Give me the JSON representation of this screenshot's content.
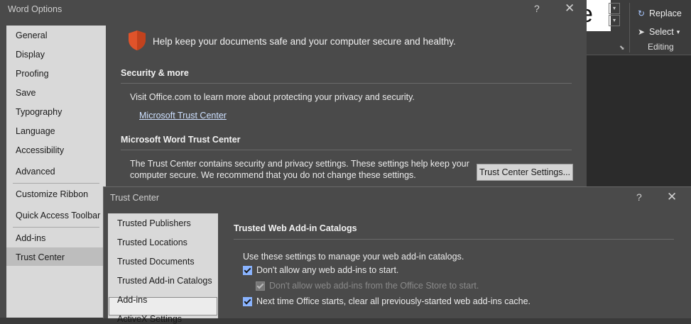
{
  "ribbon": {
    "font_preview": "e",
    "replace_label": "Replace",
    "select_label": "Select",
    "group_label": "Editing"
  },
  "word_options": {
    "title": "Word Options",
    "help": "?",
    "close": "✕",
    "nav": [
      "General",
      "Display",
      "Proofing",
      "Save",
      "Typography",
      "Language",
      "Accessibility",
      "Advanced",
      "Customize Ribbon",
      "Quick Access Toolbar",
      "Add-ins",
      "Trust Center"
    ],
    "selected_nav": "Trust Center",
    "headline": "Help keep your documents safe and your computer secure and healthy.",
    "security_title": "Security & more",
    "security_text": "Visit Office.com to learn more about protecting your privacy and security.",
    "trust_link": "Microsoft Trust Center",
    "trust_center_title": "Microsoft Word Trust Center",
    "trust_center_text_1": "The Trust Center contains security and privacy settings. These settings help keep your",
    "trust_center_text_2": "computer secure. We recommend that you do not change these settings.",
    "trust_center_button": "Trust Center Settings..."
  },
  "trust_center": {
    "title": "Trust Center",
    "help": "?",
    "close": "✕",
    "nav": [
      "Trusted Publishers",
      "Trusted Locations",
      "Trusted Documents",
      "Trusted Add-in Catalogs",
      "Add-ins",
      "ActiveX Settings"
    ],
    "selected_nav": "Trusted Add-in Catalogs",
    "heading": "Trusted Web Add-in Catalogs",
    "description": "Use these settings to manage your web add-in catalogs.",
    "checkboxes": [
      {
        "label": "Don't allow any web add-ins to start.",
        "checked": true,
        "disabled": false
      },
      {
        "label": "Don't allow web add-ins from the Office Store to start.",
        "checked": true,
        "disabled": true
      },
      {
        "label": "Next time Office starts, clear all previously-started web add-ins cache.",
        "checked": true,
        "disabled": false
      }
    ]
  },
  "colors": {
    "accent": "#8ab4ff",
    "dialog_bg": "#4a4a4a",
    "nav_bg": "#d9d9d9",
    "shield": "#e0532a"
  }
}
